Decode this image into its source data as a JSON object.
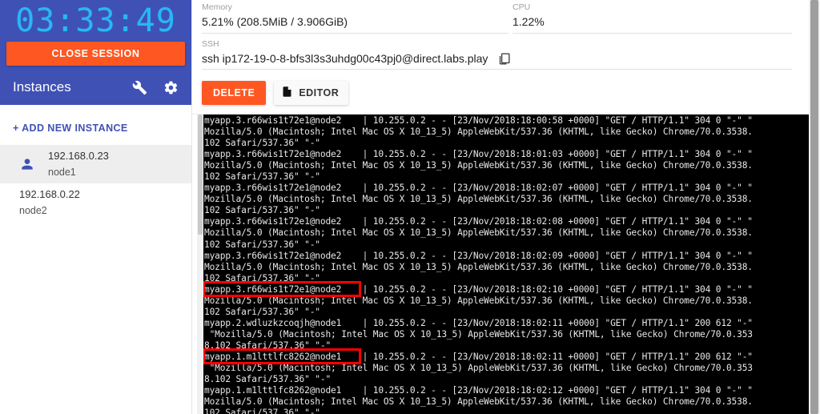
{
  "sidebar": {
    "timer": "03:33:49",
    "close_session_label": "CLOSE SESSION",
    "instances_title": "Instances",
    "wrench_icon": "wrench-icon",
    "gear_icon": "gear-icon",
    "add_instance_label": "+ ADD NEW INSTANCE",
    "instances": [
      {
        "ip": "192.168.0.23",
        "name": "node1",
        "selected": true,
        "icon": "person-icon"
      },
      {
        "ip": "192.168.0.22",
        "name": "node2",
        "selected": false,
        "icon": ""
      }
    ]
  },
  "stats": {
    "memory_label": "Memory",
    "memory_value": "5.21% (208.5MiB / 3.906GiB)",
    "cpu_label": "CPU",
    "cpu_value": "1.22%",
    "ssh_label": "SSH",
    "ssh_value": "ssh ip172-19-0-8-bfs3l3s3uhdg00c43pj0@direct.labs.play",
    "copy_icon": "copy-icon"
  },
  "actions": {
    "delete_label": "DELETE",
    "editor_label": "EDITOR",
    "editor_icon": "document-icon"
  },
  "colors": {
    "sidebar_blue": "#3f51b5",
    "accent_orange": "#ff5722",
    "timer_cyan": "#29b6f6",
    "highlight_red": "#ff0000",
    "terminal_bg": "#000000"
  },
  "terminal": {
    "lines": [
      {
        "text": "myapp.3.r66wis1t72e1@node2    | 10.255.0.2 - - [23/Nov/2018:18:00:58 +0000] \"GET / HTTP/1.1\" 304 0 \"-\" \"",
        "highlight": false
      },
      {
        "text": "Mozilla/5.0 (Macintosh; Intel Mac OS X 10_13_5) AppleWebKit/537.36 (KHTML, like Gecko) Chrome/70.0.3538.",
        "highlight": false
      },
      {
        "text": "102 Safari/537.36\" \"-\"",
        "highlight": false
      },
      {
        "text": "myapp.3.r66wis1t72e1@node2    | 10.255.0.2 - - [23/Nov/2018:18:01:03 +0000] \"GET / HTTP/1.1\" 304 0 \"-\" \"",
        "highlight": false
      },
      {
        "text": "Mozilla/5.0 (Macintosh; Intel Mac OS X 10_13_5) AppleWebKit/537.36 (KHTML, like Gecko) Chrome/70.0.3538.",
        "highlight": false
      },
      {
        "text": "102 Safari/537.36\" \"-\"",
        "highlight": false
      },
      {
        "text": "myapp.3.r66wis1t72e1@node2    | 10.255.0.2 - - [23/Nov/2018:18:02:07 +0000] \"GET / HTTP/1.1\" 304 0 \"-\" \"",
        "highlight": false
      },
      {
        "text": "Mozilla/5.0 (Macintosh; Intel Mac OS X 10_13_5) AppleWebKit/537.36 (KHTML, like Gecko) Chrome/70.0.3538.",
        "highlight": false
      },
      {
        "text": "102 Safari/537.36\" \"-\"",
        "highlight": false
      },
      {
        "text": "myapp.3.r66wis1t72e1@node2    | 10.255.0.2 - - [23/Nov/2018:18:02:08 +0000] \"GET / HTTP/1.1\" 304 0 \"-\" \"",
        "highlight": false
      },
      {
        "text": "Mozilla/5.0 (Macintosh; Intel Mac OS X 10_13_5) AppleWebKit/537.36 (KHTML, like Gecko) Chrome/70.0.3538.",
        "highlight": false
      },
      {
        "text": "102 Safari/537.36\" \"-\"",
        "highlight": false
      },
      {
        "text": "myapp.3.r66wis1t72e1@node2    | 10.255.0.2 - - [23/Nov/2018:18:02:09 +0000] \"GET / HTTP/1.1\" 304 0 \"-\" \"",
        "highlight": false
      },
      {
        "text": "Mozilla/5.0 (Macintosh; Intel Mac OS X 10_13_5) AppleWebKit/537.36 (KHTML, like Gecko) Chrome/70.0.3538.",
        "highlight": false
      },
      {
        "text": "102 Safari/537.36\" \"-\"",
        "highlight": false
      },
      {
        "text": "myapp.3.r66wis1t72e1@node2    | 10.255.0.2 - - [23/Nov/2018:18:02:10 +0000] \"GET / HTTP/1.1\" 304 0 \"-\" \"",
        "highlight": true,
        "highlight_width": 198
      },
      {
        "text": "Mozilla/5.0 (Macintosh; Intel Mac OS X 10_13_5) AppleWebKit/537.36 (KHTML, like Gecko) Chrome/70.0.3538.",
        "highlight": false
      },
      {
        "text": "102 Safari/537.36\" \"-\"",
        "highlight": false
      },
      {
        "text": "myapp.2.wdluzkzcoqjh@node1    | 10.255.0.2 - - [23/Nov/2018:18:02:11 +0000] \"GET / HTTP/1.1\" 200 612 \"-\"",
        "highlight": false
      },
      {
        "text": " \"Mozilla/5.0 (Macintosh; Intel Mac OS X 10_13_5) AppleWebKit/537.36 (KHTML, like Gecko) Chrome/70.0.353",
        "highlight": false
      },
      {
        "text": "8.102 Safari/537.36\" \"-\"",
        "highlight": false
      },
      {
        "text": "myapp.1.m1lttlfc8262@node1    | 10.255.0.2 - - [23/Nov/2018:18:02:11 +0000] \"GET / HTTP/1.1\" 200 612 \"-\"",
        "highlight": true,
        "highlight_width": 198
      },
      {
        "text": " \"Mozilla/5.0 (Macintosh; Intel Mac OS X 10_13_5) AppleWebKit/537.36 (KHTML, like Gecko) Chrome/70.0.353",
        "highlight": false
      },
      {
        "text": "8.102 Safari/537.36\" \"-\"",
        "highlight": false
      },
      {
        "text": "myapp.1.m1lttlfc8262@node1    | 10.255.0.2 - - [23/Nov/2018:18:02:12 +0000] \"GET / HTTP/1.1\" 304 0 \"-\" \"",
        "highlight": false
      },
      {
        "text": "Mozilla/5.0 (Macintosh; Intel Mac OS X 10_13_5) AppleWebKit/537.36 (KHTML, like Gecko) Chrome/70.0.3538.",
        "highlight": false
      },
      {
        "text": "102 Safari/537.36\" \"-\"",
        "highlight": false
      }
    ]
  }
}
